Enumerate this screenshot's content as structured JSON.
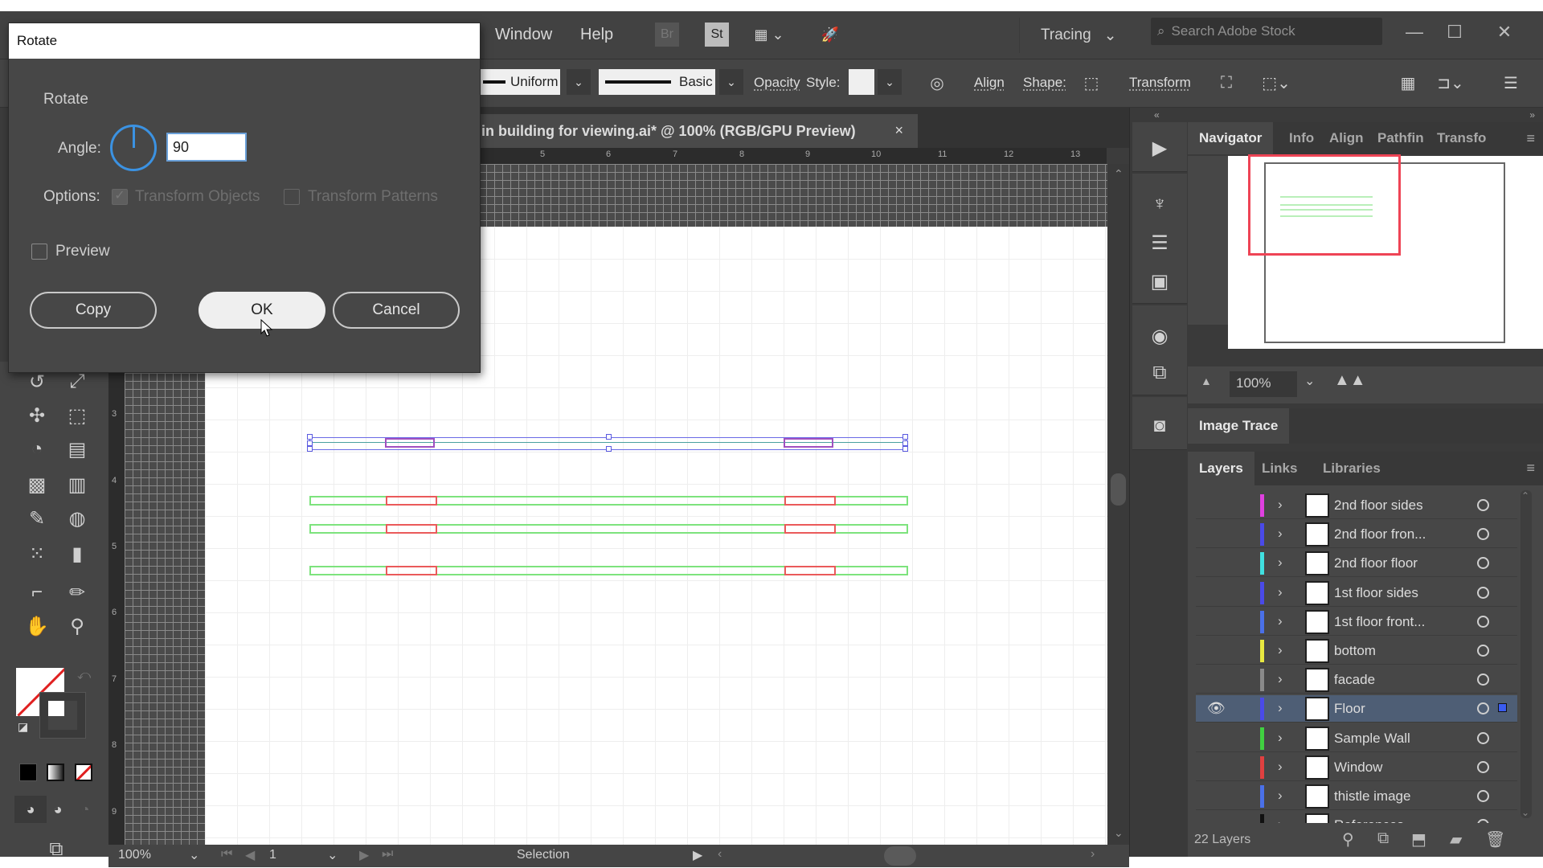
{
  "menubar": {
    "items": [
      "Window",
      "Help"
    ],
    "app_icons": [
      {
        "name": "bridge-icon",
        "label": "Br"
      },
      {
        "name": "stock-icon",
        "label": "St"
      },
      {
        "name": "arrange-documents-icon",
        "label": ""
      },
      {
        "name": "gpu-performance-icon",
        "label": ""
      }
    ],
    "workspace": "Tracing",
    "search_placeholder": "Search Adobe Stock"
  },
  "controlbar": {
    "stroke_profile": "Uniform",
    "brush": "Basic",
    "opacity_label": "Opacity",
    "style_label": "Style:",
    "align_label": "Align",
    "shape_label": "Shape:",
    "transform_label": "Transform"
  },
  "document": {
    "tab_title": "in building for viewing.ai* @ 100% (RGB/GPU Preview)",
    "close": "×"
  },
  "rulers": {
    "horizontal": [
      "5",
      "6",
      "7",
      "8",
      "9",
      "10",
      "11",
      "12",
      "13"
    ],
    "vertical": [
      "3",
      "4",
      "5",
      "6",
      "7",
      "8",
      "9"
    ]
  },
  "statusbar": {
    "zoom": "100%",
    "artboard": "1",
    "tool": "Selection"
  },
  "dialog": {
    "title": "Rotate",
    "section": "Rotate",
    "angle_label": "Angle:",
    "angle_value": "90",
    "options_label": "Options:",
    "transform_objects": {
      "label": "Transform Objects",
      "checked": true,
      "enabled": false
    },
    "transform_patterns": {
      "label": "Transform Patterns",
      "checked": false,
      "enabled": false
    },
    "preview": {
      "label": "Preview",
      "checked": false
    },
    "buttons": {
      "copy": "Copy",
      "ok": "OK",
      "cancel": "Cancel"
    }
  },
  "panels": {
    "top_tabs": [
      "Navigator",
      "Info",
      "Align",
      "Pathfin",
      "Transfo"
    ],
    "navigator_zoom": "100%",
    "image_trace_tab": "Image Trace",
    "layer_tabs": [
      "Layers",
      "Links",
      "Libraries"
    ],
    "layers": [
      {
        "name": "2nd floor sides",
        "color": "#e040e0",
        "visible": false,
        "selected": false
      },
      {
        "name": "2nd floor fron...",
        "color": "#4a4ae8",
        "visible": false,
        "selected": false
      },
      {
        "name": "2nd floor floor",
        "color": "#40e0e0",
        "visible": false,
        "selected": false
      },
      {
        "name": "1st floor sides",
        "color": "#4a4ae8",
        "visible": false,
        "selected": false
      },
      {
        "name": "1st floor front...",
        "color": "#4a70e8",
        "visible": false,
        "selected": false
      },
      {
        "name": "bottom",
        "color": "#e8e840",
        "visible": false,
        "selected": false
      },
      {
        "name": "facade",
        "color": "#8a8a8a",
        "visible": false,
        "selected": false
      },
      {
        "name": "Floor",
        "color": "#4a4ae8",
        "visible": true,
        "selected": true
      },
      {
        "name": "Sample Wall",
        "color": "#40d040",
        "visible": false,
        "selected": false
      },
      {
        "name": "Window",
        "color": "#e04040",
        "visible": false,
        "selected": false
      },
      {
        "name": "thistle image",
        "color": "#4a70e8",
        "visible": false,
        "selected": false
      },
      {
        "name": "References",
        "color": "#111111",
        "visible": false,
        "selected": false
      }
    ],
    "layer_count": "22 Layers"
  },
  "colors": {
    "dialog_accent": "#3b92e2",
    "wall_stroke": "#7de37d",
    "window_stroke": "#ea5a5a",
    "selection": "#6a6ae6",
    "navigator_view": "#ee4455"
  }
}
